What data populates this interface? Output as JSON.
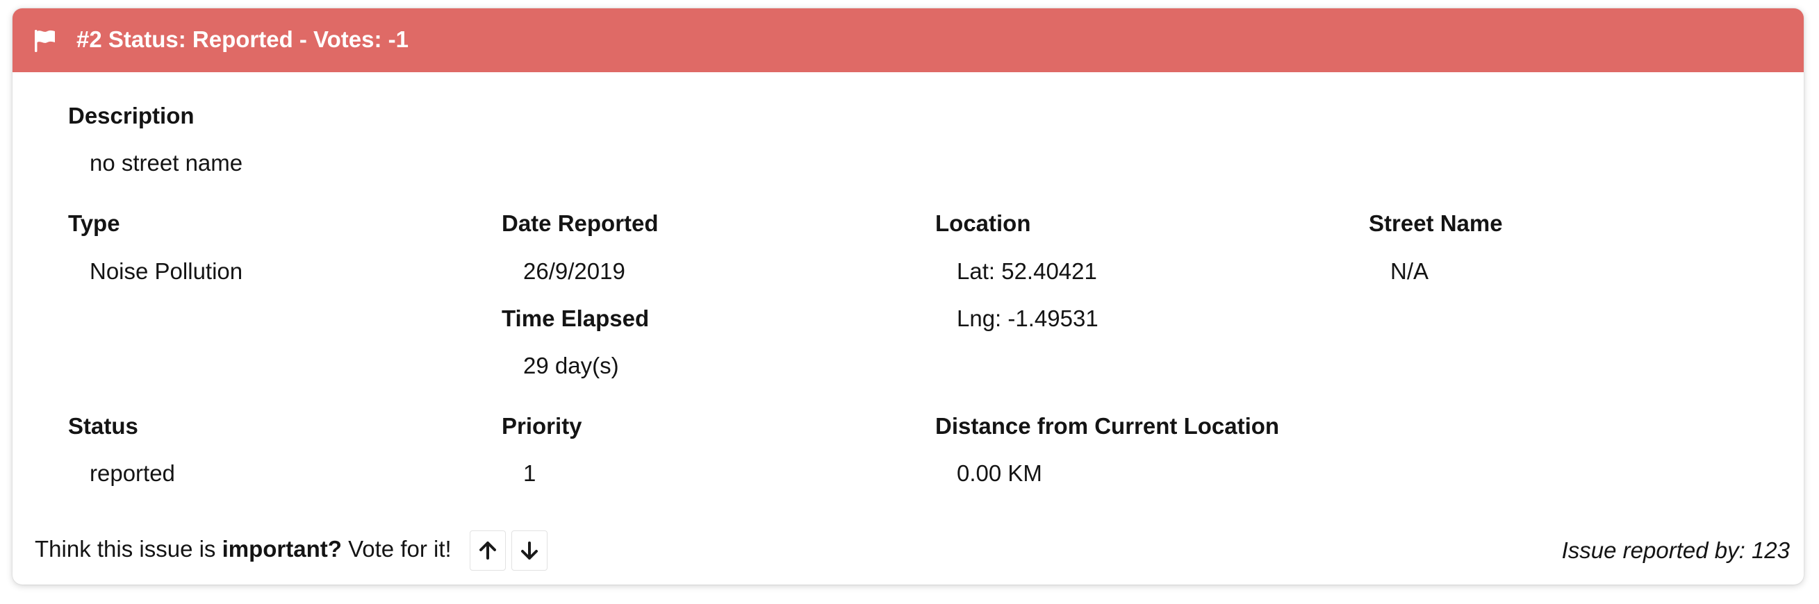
{
  "colors": {
    "header_bg": "#df6a66",
    "header_text": "#ffffff"
  },
  "header": {
    "icon": "flag-icon",
    "title": "#2 Status: Reported - Votes: -1"
  },
  "description": {
    "label": "Description",
    "value": "no street name"
  },
  "type": {
    "label": "Type",
    "value": "Noise Pollution"
  },
  "date_reported": {
    "label": "Date Reported",
    "value": "26/9/2019"
  },
  "time_elapsed": {
    "label": "Time Elapsed",
    "value": "29 day(s)"
  },
  "location": {
    "label": "Location",
    "lat": "Lat: 52.40421",
    "lng": "Lng: -1.49531"
  },
  "street_name": {
    "label": "Street Name",
    "value": "N/A"
  },
  "status": {
    "label": "Status",
    "value": "reported"
  },
  "priority": {
    "label": "Priority",
    "value": "1"
  },
  "distance": {
    "label": "Distance from Current Location",
    "value": "0.00 KM"
  },
  "footer": {
    "prompt_before": "Think this issue is ",
    "prompt_bold": "important?",
    "prompt_after": " Vote for it!",
    "upvote_icon": "arrow-up-icon",
    "downvote_icon": "arrow-down-icon",
    "reported_by": "Issue reported by: 123"
  }
}
